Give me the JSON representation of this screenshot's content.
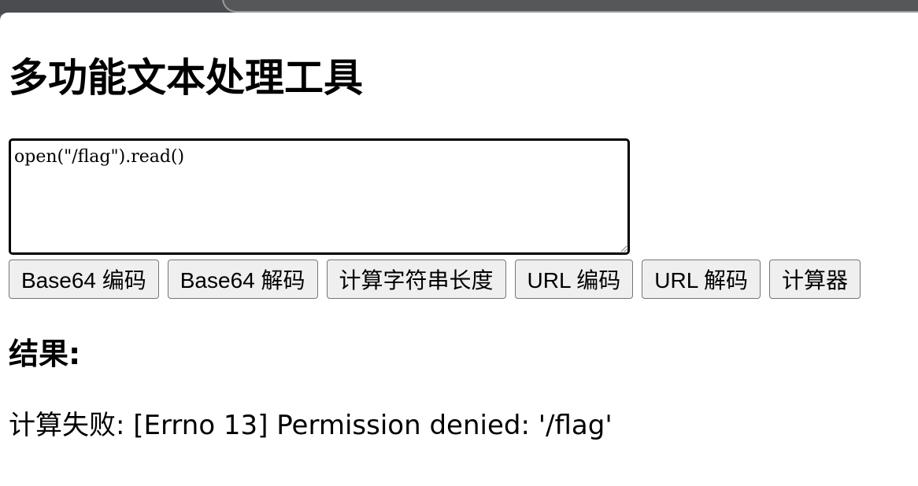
{
  "page": {
    "title": "多功能文本处理工具"
  },
  "input": {
    "value": "open(\"/flag\").read()"
  },
  "buttons": [
    {
      "label": "Base64 编码"
    },
    {
      "label": "Base64 解码"
    },
    {
      "label": "计算字符串长度"
    },
    {
      "label": "URL 编码"
    },
    {
      "label": "URL 解码"
    },
    {
      "label": "计算器"
    }
  ],
  "result": {
    "heading": "结果:",
    "text": "计算失败: [Errno 13] Permission denied: '/flag'"
  }
}
